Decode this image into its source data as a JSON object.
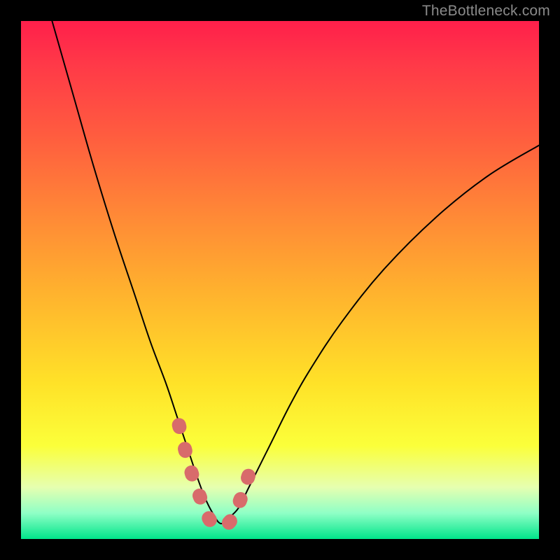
{
  "watermark": "TheBottleneck.com",
  "chart_data": {
    "type": "line",
    "title": "",
    "xlabel": "",
    "ylabel": "",
    "xlim": [
      0,
      100
    ],
    "ylim": [
      0,
      100
    ],
    "grid": false,
    "series": [
      {
        "name": "bottleneck-curve",
        "color": "#000000",
        "x": [
          6,
          10,
          14,
          18,
          22,
          25,
          28,
          30,
          32,
          34,
          35.5,
          37,
          38.5,
          40,
          42,
          44,
          48,
          52,
          56,
          62,
          70,
          80,
          90,
          100
        ],
        "y": [
          100,
          86,
          72,
          59,
          47,
          38,
          30,
          24,
          18,
          12,
          8,
          5,
          3,
          4,
          6,
          10,
          18,
          26,
          33,
          42,
          52,
          62,
          70,
          76
        ]
      },
      {
        "name": "highlight-valley",
        "color": "#d86b6b",
        "x": [
          30.5,
          32,
          33.5,
          35,
          36,
          37,
          38,
          39,
          40,
          41,
          42.5,
          44.5
        ],
        "y": [
          22,
          16,
          11,
          7,
          4.5,
          3,
          2.5,
          2.5,
          3,
          4.5,
          8,
          14
        ]
      }
    ],
    "gradient_stops": [
      {
        "offset": 0,
        "color": "#ff1f4b"
      },
      {
        "offset": 8,
        "color": "#ff3848"
      },
      {
        "offset": 22,
        "color": "#ff5c3f"
      },
      {
        "offset": 38,
        "color": "#ff8a36"
      },
      {
        "offset": 52,
        "color": "#ffb12e"
      },
      {
        "offset": 70,
        "color": "#ffe228"
      },
      {
        "offset": 82,
        "color": "#fbff3a"
      },
      {
        "offset": 90,
        "color": "#e6ffb0"
      },
      {
        "offset": 95,
        "color": "#8fffc6"
      },
      {
        "offset": 100,
        "color": "#00e58a"
      }
    ]
  }
}
